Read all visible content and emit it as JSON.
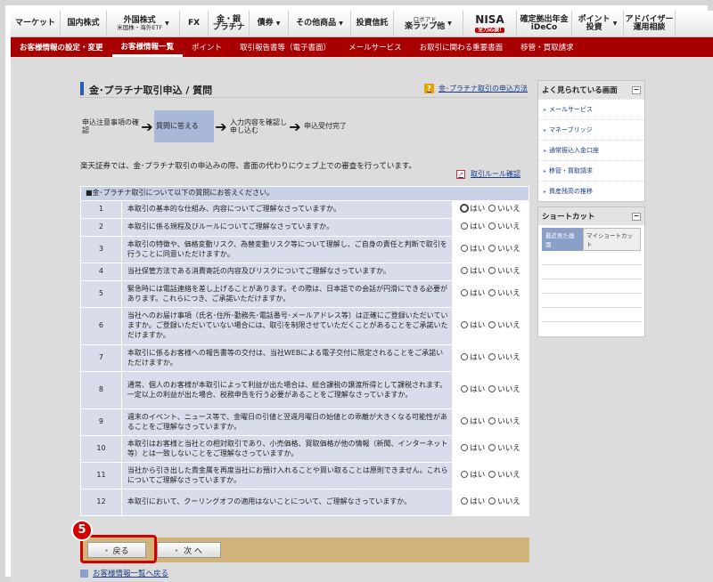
{
  "global_nav": [
    {
      "label": "マーケット",
      "has_arrow": false
    },
    {
      "label": "国内株式",
      "has_arrow": false
    },
    {
      "label": "外国株式",
      "sub": "米国株・海外ETF",
      "has_arrow": true
    },
    {
      "label": "FX",
      "has_arrow": false
    },
    {
      "label": "金・銀",
      "sub": "プラチナ",
      "has_arrow": false
    },
    {
      "label": "債券",
      "has_arrow": true
    },
    {
      "label": "その他商品",
      "has_arrow": true
    },
    {
      "label": "投資信託",
      "has_arrow": false
    },
    {
      "label": "ロボアド",
      "sub": "楽ラップ他",
      "has_arrow": true
    },
    {
      "label": "NISA",
      "sub": "全力応援!",
      "has_arrow": false
    },
    {
      "label": "確定拠出年金",
      "sub": "iDeCo",
      "has_arrow": false
    },
    {
      "label": "ポイント",
      "sub": "投資",
      "has_arrow": true
    },
    {
      "label": "アドバイザー",
      "sub": "運用相談",
      "has_arrow": false
    }
  ],
  "sub_nav": [
    {
      "label": "お客様情報の設定・変更",
      "style": "bold"
    },
    {
      "label": "お客様情報一覧",
      "style": "active"
    },
    {
      "label": "ポイント",
      "style": ""
    },
    {
      "label": "取引報告書等（電子書面）",
      "style": ""
    },
    {
      "label": "メールサービス",
      "style": ""
    },
    {
      "label": "お取引に関わる重要書面",
      "style": ""
    },
    {
      "label": "移管・買取請求",
      "style": ""
    }
  ],
  "page": {
    "title": "金･プラチナ取引申込 / 質問",
    "help_link": "金･プラチナ取引の申込方法",
    "help_icon": "?",
    "steps": [
      {
        "label": "申込注意事項の確認",
        "active": false
      },
      {
        "label": "質問に答える",
        "active": true
      },
      {
        "label": "入力内容を確認し申し込む",
        "active": false
      },
      {
        "label": "申込受付完了",
        "active": false
      }
    ],
    "step_arrow": "➔",
    "intro": "楽天証券では、金･プラチナ取引の申込みの際、書面の代わりにウェブ上での審査を行っています。",
    "rule_link": "取引ルール確認",
    "table_header": "■金･プラチナ取引について以下の質問にお答えください。",
    "answer_yes": "はい",
    "answer_no": "いいえ",
    "questions": [
      {
        "no": "1",
        "text": "本取引の基本的な仕組み、内容についてご理解なさっていますか。"
      },
      {
        "no": "2",
        "text": "本取引に係る規程及びルールについてご理解なさっていますか。"
      },
      {
        "no": "3",
        "text": "本取引の特徴や、価格変動リスク、為替変動リスク等について理解し、ご自身の責任と判断で取引を行うことに同意いただけますか。"
      },
      {
        "no": "4",
        "text": "当社保管方法である消費寄託の内容及びリスクについてご理解なさっていますか。"
      },
      {
        "no": "5",
        "text": "緊急時には電話連絡を差し上げることがあります。その際は、日本語での会話が円滑にできる必要があります。これらにつき、ご承諾いただけますか。"
      },
      {
        "no": "6",
        "text": "当社へのお届け事項（氏名･住所･勤務先･電話番号･メールアドレス等）は正確にご登録いただいていますか。ご登録いただいていない場合には、取引を制限させていただくことがあることをご承諾いただけますか。"
      },
      {
        "no": "7",
        "text": "本取引に係るお客様への報告書等の交付は、当社WEBによる電子交付に限定されることをご承諾いただけますか。"
      },
      {
        "no": "8",
        "text": "通常、個人のお客様が本取引によって利益が出た場合は、総合課税の譲渡所得として課税されます。一定以上の利益が出た場合、税務申告を行う必要があることをご理解なさっていますか。"
      },
      {
        "no": "9",
        "text": "週末のイベント、ニュース等で、金曜日の引値と翌週月曜日の始値との乖離が大きくなる可能性があることをご理解なさっていますか。"
      },
      {
        "no": "10",
        "text": "本取引はお客様と当社との相対取引であり、小売価格、買取価格が他の情報（新聞、インターネット等）とは一致しないことをご理解なさっていますか。"
      },
      {
        "no": "11",
        "text": "当社から引き出した貴金属を再度当社にお預け入れることや買い取ることは原則できません。これらについてご理解なさっていますか。"
      },
      {
        "no": "12",
        "text": "本取引において、クーリングオフの適用はないことについて、ご理解なさっていますか。"
      }
    ],
    "back_button": "戻る",
    "next_button": "次 へ",
    "step_badge": "5",
    "back_to_list": "お客様情報一覧へ戻る"
  },
  "sidebar": {
    "popular_title": "よく見られている画面",
    "popular_links": [
      "メールサービス",
      "マネーブリッジ",
      "通常振込入金口座",
      "移管・買取請求",
      "資産残高の推移"
    ],
    "shortcut_title": "ショートカット",
    "shortcut_tabs": [
      "最近見た画面",
      "マイショートカット"
    ],
    "collapse_label": "−"
  },
  "colors": {
    "brand_red": "#a80000",
    "accent_blue": "#2a5db0",
    "callout_red": "#d40000",
    "button_bar": "#d2b47a"
  }
}
